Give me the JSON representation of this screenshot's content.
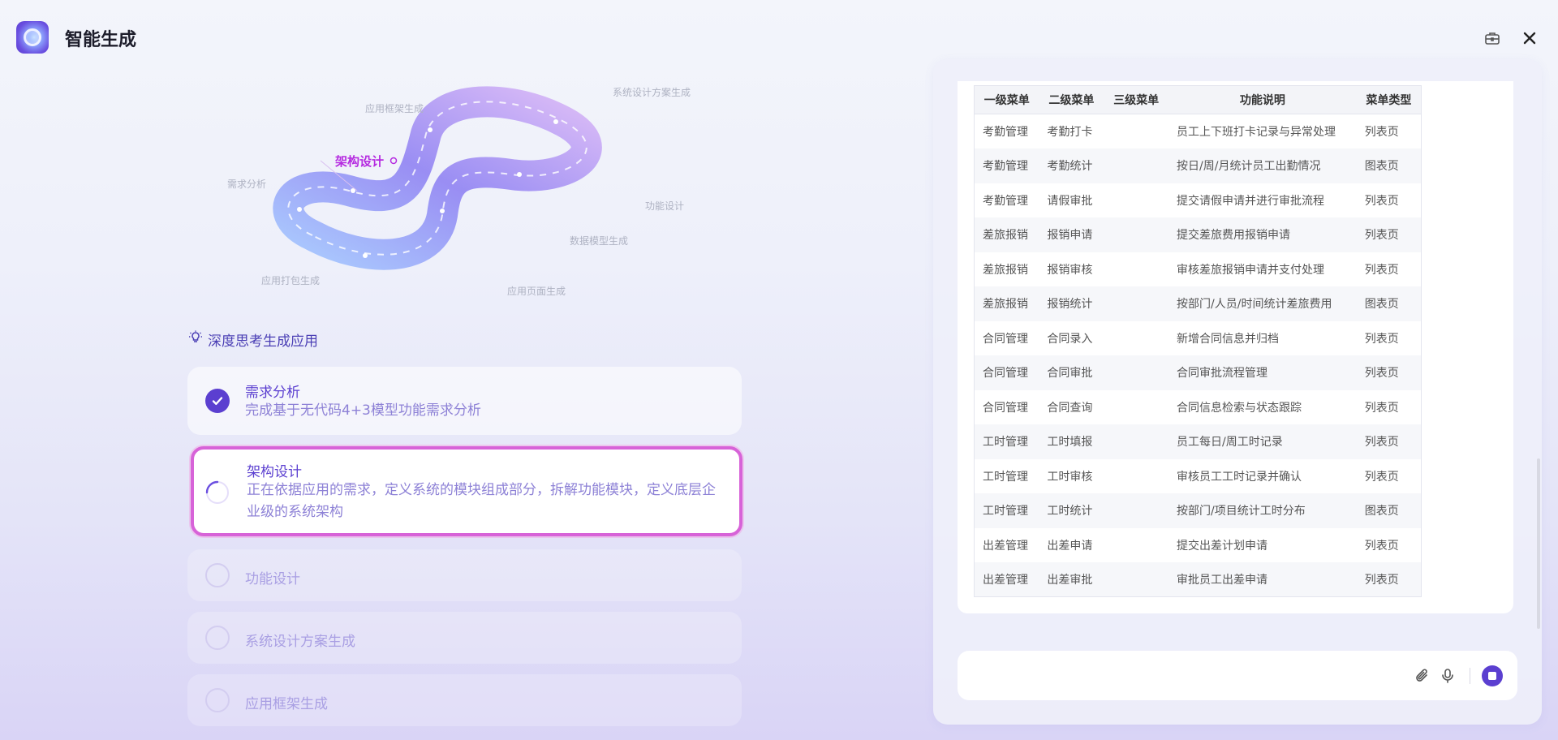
{
  "header": {
    "title": "智能生成"
  },
  "diagram": {
    "labels": {
      "framework": "应用框架生成",
      "system_design": "系统设计方案生成",
      "architecture": "架构设计",
      "requirements": "需求分析",
      "function_design": "功能设计",
      "data_model": "数据模型生成",
      "packaging": "应用打包生成",
      "page_gen": "应用页面生成"
    }
  },
  "steps": {
    "title": "深度思考生成应用",
    "items": [
      {
        "name": "需求分析",
        "desc": "完成基于无代码4+3模型功能需求分析",
        "status": "done"
      },
      {
        "name": "架构设计",
        "desc": "正在依据应用的需求，定义系统的模块组成部分，拆解功能模块，定义底层企业级的系统架构",
        "status": "running"
      },
      {
        "name": "功能设计",
        "status": "pending"
      },
      {
        "name": "系统设计方案生成",
        "status": "pending"
      },
      {
        "name": "应用框架生成",
        "status": "pending"
      }
    ]
  },
  "table": {
    "headers": [
      "一级菜单",
      "二级菜单",
      "三级菜单",
      "功能说明",
      "菜单类型"
    ],
    "rows": [
      [
        "考勤管理",
        "考勤打卡",
        "",
        "员工上下班打卡记录与异常处理",
        "列表页"
      ],
      [
        "考勤管理",
        "考勤统计",
        "",
        "按日/周/月统计员工出勤情况",
        "图表页"
      ],
      [
        "考勤管理",
        "请假审批",
        "",
        "提交请假申请并进行审批流程",
        "列表页"
      ],
      [
        "差旅报销",
        "报销申请",
        "",
        "提交差旅费用报销申请",
        "列表页"
      ],
      [
        "差旅报销",
        "报销审核",
        "",
        "审核差旅报销申请并支付处理",
        "列表页"
      ],
      [
        "差旅报销",
        "报销统计",
        "",
        "按部门/人员/时间统计差旅费用",
        "图表页"
      ],
      [
        "合同管理",
        "合同录入",
        "",
        "新增合同信息并归档",
        "列表页"
      ],
      [
        "合同管理",
        "合同审批",
        "",
        "合同审批流程管理",
        "列表页"
      ],
      [
        "合同管理",
        "合同查询",
        "",
        "合同信息检索与状态跟踪",
        "列表页"
      ],
      [
        "工时管理",
        "工时填报",
        "",
        "员工每日/周工时记录",
        "列表页"
      ],
      [
        "工时管理",
        "工时审核",
        "",
        "审核员工工时记录并确认",
        "列表页"
      ],
      [
        "工时管理",
        "工时统计",
        "",
        "按部门/项目统计工时分布",
        "图表页"
      ],
      [
        "出差管理",
        "出差申请",
        "",
        "提交出差计划申请",
        "列表页"
      ],
      [
        "出差管理",
        "出差审批",
        "",
        "审批员工出差申请",
        "列表页"
      ]
    ]
  },
  "colors": {
    "accent": "#5b3fd0",
    "active_border": "#d763d8",
    "active_label": "#b52be0"
  }
}
